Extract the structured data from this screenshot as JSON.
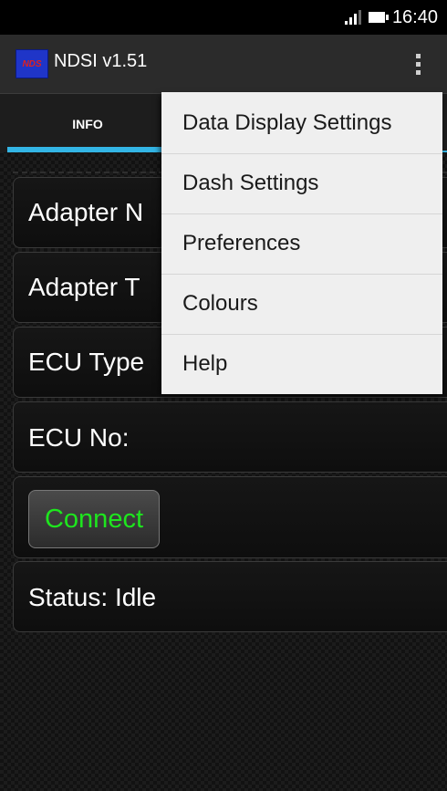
{
  "status_bar": {
    "time": "16:40"
  },
  "action_bar": {
    "app_icon_text": "NDS",
    "title": "NDSI v1.51"
  },
  "tabs": [
    {
      "label": "INFO"
    }
  ],
  "rows": {
    "adapter_name": "Adapter N",
    "adapter_type": "Adapter T",
    "ecu_type": "ECU Type",
    "ecu_no": "ECU No:",
    "connect_label": "Connect",
    "status": "Status: Idle"
  },
  "menu": {
    "items": [
      {
        "label": "Data Display Settings"
      },
      {
        "label": "Dash Settings"
      },
      {
        "label": "Preferences"
      },
      {
        "label": "Colours"
      },
      {
        "label": "Help"
      }
    ]
  },
  "colors": {
    "tab_indicator": "#33b5e5",
    "connect_text": "#1ee61e",
    "app_icon_bg": "#1f35c8",
    "app_icon_text": "#e02020"
  }
}
